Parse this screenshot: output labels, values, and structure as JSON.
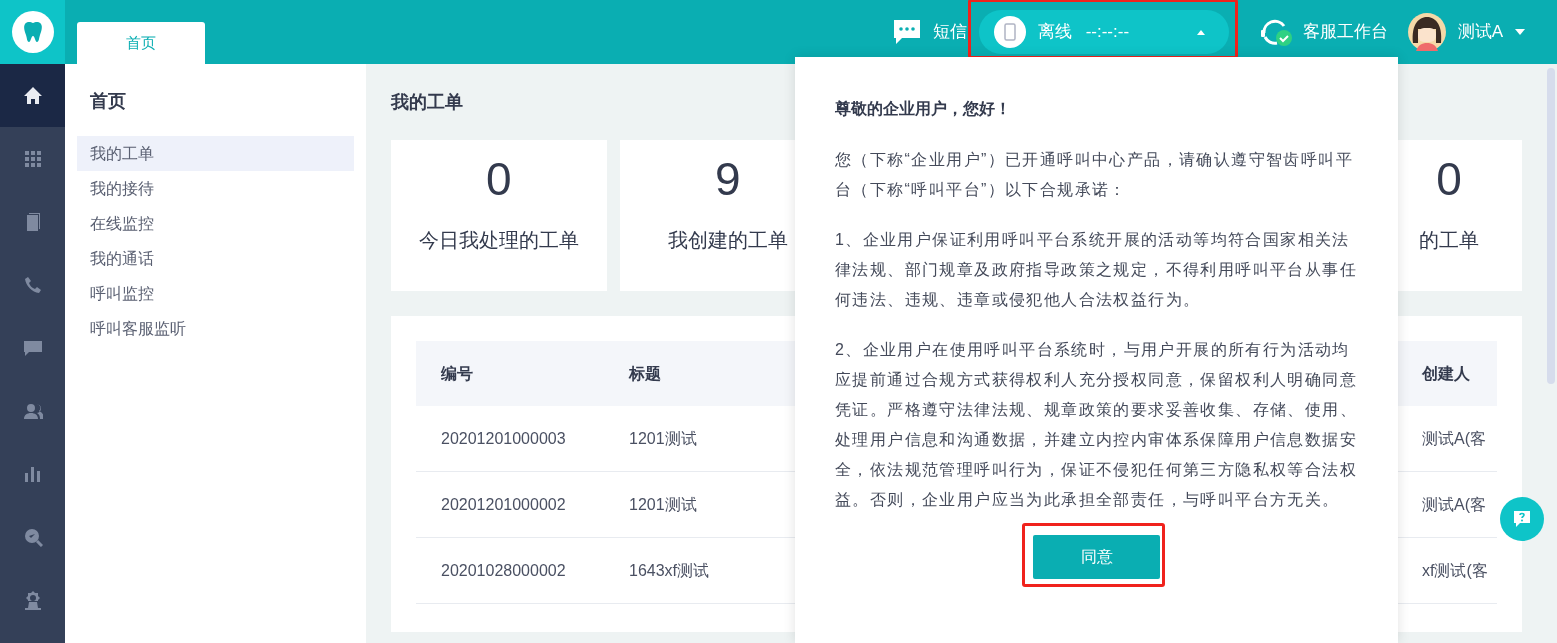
{
  "top_tabs": [
    {
      "label": "首页",
      "selected": true
    }
  ],
  "header": {
    "sms": {
      "label": "短信"
    },
    "status": {
      "label": "离线",
      "timer": "--:--:--",
      "expanded": true,
      "highlighted": true
    },
    "workbench": {
      "label": "客服工作台"
    },
    "user": {
      "name": "测试A"
    }
  },
  "rail": [
    {
      "selected": true
    },
    {
      "selected": false
    },
    {
      "selected": false
    },
    {
      "selected": false
    },
    {
      "selected": false
    },
    {
      "selected": false
    },
    {
      "selected": false
    },
    {
      "selected": false
    },
    {
      "selected": false
    }
  ],
  "sidebar": {
    "title": "首页",
    "items": [
      {
        "label": "我的工单",
        "selected": true
      },
      {
        "label": "我的接待",
        "selected": false
      },
      {
        "label": "在线监控",
        "selected": false
      },
      {
        "label": "我的通话",
        "selected": false
      },
      {
        "label": "呼叫监控",
        "selected": false
      },
      {
        "label": "呼叫客服监听",
        "selected": false
      }
    ]
  },
  "page_title": "我的工单",
  "stats": [
    {
      "value": "0",
      "label": "今日我处理的工单"
    },
    {
      "value": "9",
      "label": "我创建的工单"
    },
    {
      "value": "0",
      "label": "的工单"
    }
  ],
  "table": {
    "columns": [
      "编号",
      "标题",
      "创建人"
    ],
    "rows": [
      [
        "20201201000003",
        "1201测试",
        "测试A(客"
      ],
      [
        "20201201000002",
        "1201测试",
        "测试A(客"
      ],
      [
        "20201028000002",
        "1643xf测试",
        "xf测试(客"
      ]
    ]
  },
  "notice": {
    "title": "尊敬的企业用户，您好！",
    "paragraphs": [
      "您（下称“企业用户”）已开通呼叫中心产品，请确认遵守智齿呼叫平台（下称“呼叫平台”）以下合规承诺：",
      "1、企业用户保证利用呼叫平台系统开展的活动等均符合国家相关法律法规、部门规章及政府指导政策之规定，不得利用呼叫平台从事任何违法、违规、违章或侵犯他人合法权益行为。",
      "2、企业用户在使用呼叫平台系统时，与用户开展的所有行为活动均应提前通过合规方式获得权利人充分授权同意，保留权利人明确同意凭证。严格遵守法律法规、规章政策的要求妥善收集、存储、使用、处理用户信息和沟通数据，并建立内控内审体系保障用户信息数据安全，依法规范管理呼叫行为，保证不侵犯任何第三方隐私权等合法权益。否则，企业用户应当为此承担全部责任，与呼叫平台方无关。"
    ],
    "button": {
      "label": "同意",
      "highlighted": true
    }
  }
}
